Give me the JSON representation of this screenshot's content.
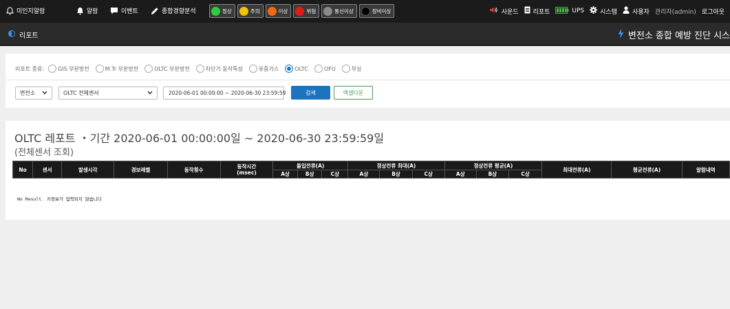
{
  "topbar": {
    "unacked_alarm": "미인지알람",
    "alarm": "알람",
    "event": "이벤트",
    "trend": "종합경향분석",
    "statuses": [
      {
        "label": "정상",
        "color": "#2ecc40"
      },
      {
        "label": "주의",
        "color": "#f5c400"
      },
      {
        "label": "이상",
        "color": "#f06a0f"
      },
      {
        "label": "위험",
        "color": "#e41b1b"
      },
      {
        "label": "통신이상",
        "color": "#8a8a8a"
      },
      {
        "label": "장비이상",
        "color": "#000000"
      }
    ],
    "sound": "사운드",
    "report": "리포트",
    "ups": "UPS",
    "system": "시스템",
    "user": "사용자",
    "admin": "관리자(admin)",
    "logout": "로그아웃"
  },
  "subheader": {
    "page": "리포트",
    "system_title": "변전소 종합 예방 진단 시스"
  },
  "filter": {
    "type_label": "리포트 종류:",
    "types": [
      {
        "label": "GIS 부분방전",
        "checked": false
      },
      {
        "label": "M.Tr 부분방전",
        "checked": false
      },
      {
        "label": "OLTC 부분방전",
        "checked": false
      },
      {
        "label": "차단기 동작특성",
        "checked": false
      },
      {
        "label": "유중가스",
        "checked": false
      },
      {
        "label": "OLTC",
        "checked": true
      },
      {
        "label": "OFU",
        "checked": false
      },
      {
        "label": "부싱",
        "checked": false
      }
    ],
    "substation": "변전소",
    "sensor": "OLTC 전체센서",
    "date_range": "2020-06-01 00:00:00 ~ 2020-06-30 23:59:59",
    "search": "검색",
    "excel": "엑셀다운"
  },
  "report": {
    "title": "OLTC 레포트 ・기간 2020-06-01 00:00:00일 ~ 2020-06-30 23:59:59일",
    "subtitle": "(전체센서 조회)",
    "columns": {
      "no": "No",
      "sensor": "센서",
      "time": "발생시각",
      "alarm_level": "경보레벨",
      "op_count": "동작횟수",
      "op_time": "동작시간\n(msec)",
      "inrush": "돌입전류(A)",
      "steady_max": "정상전류 최대(A)",
      "steady_avg": "정상전류 평균(A)",
      "max_current": "최대전류(A)",
      "avg_current": "평균전류(A)",
      "alarm_detail": "알람내역",
      "phase_a": "A상",
      "phase_b": "B상",
      "phase_c": "C상"
    },
    "no_result": "No Result. 키정보가 입력되지 않습니다"
  }
}
